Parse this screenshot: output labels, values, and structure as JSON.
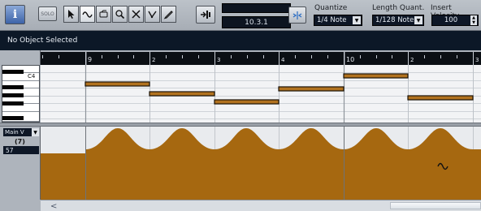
{
  "toolbar": {
    "info_label": "i",
    "solo_label": "SOLO",
    "tools": [
      "arrow-tool-icon",
      "line-tool-icon",
      "glue-tool-icon",
      "zoom-tool-icon",
      "mute-tool-icon",
      "split-tool-icon",
      "draw-tool-icon"
    ],
    "active_tool_index": 1,
    "position_display": "10.3.1",
    "quantize": {
      "label": "Quantize",
      "value": "1/4 Note"
    },
    "length_quant": {
      "label": "Length Quant.",
      "value": "1/128 Note"
    },
    "insert_velocity": {
      "label": "Insert Velocity",
      "value": "100"
    }
  },
  "status": {
    "text": "No Object Selected"
  },
  "ruler": {
    "bars": [
      "9",
      "2",
      "3",
      "4",
      "10",
      "2",
      "3"
    ]
  },
  "keyboard": {
    "label": "C4"
  },
  "controller": {
    "lane_name": "Main V",
    "controller_number": "(7)",
    "value": "57"
  },
  "colors": {
    "note_fill": "#b1721f",
    "controller_fill": "#a66810",
    "status_bg": "#0c1827"
  }
}
